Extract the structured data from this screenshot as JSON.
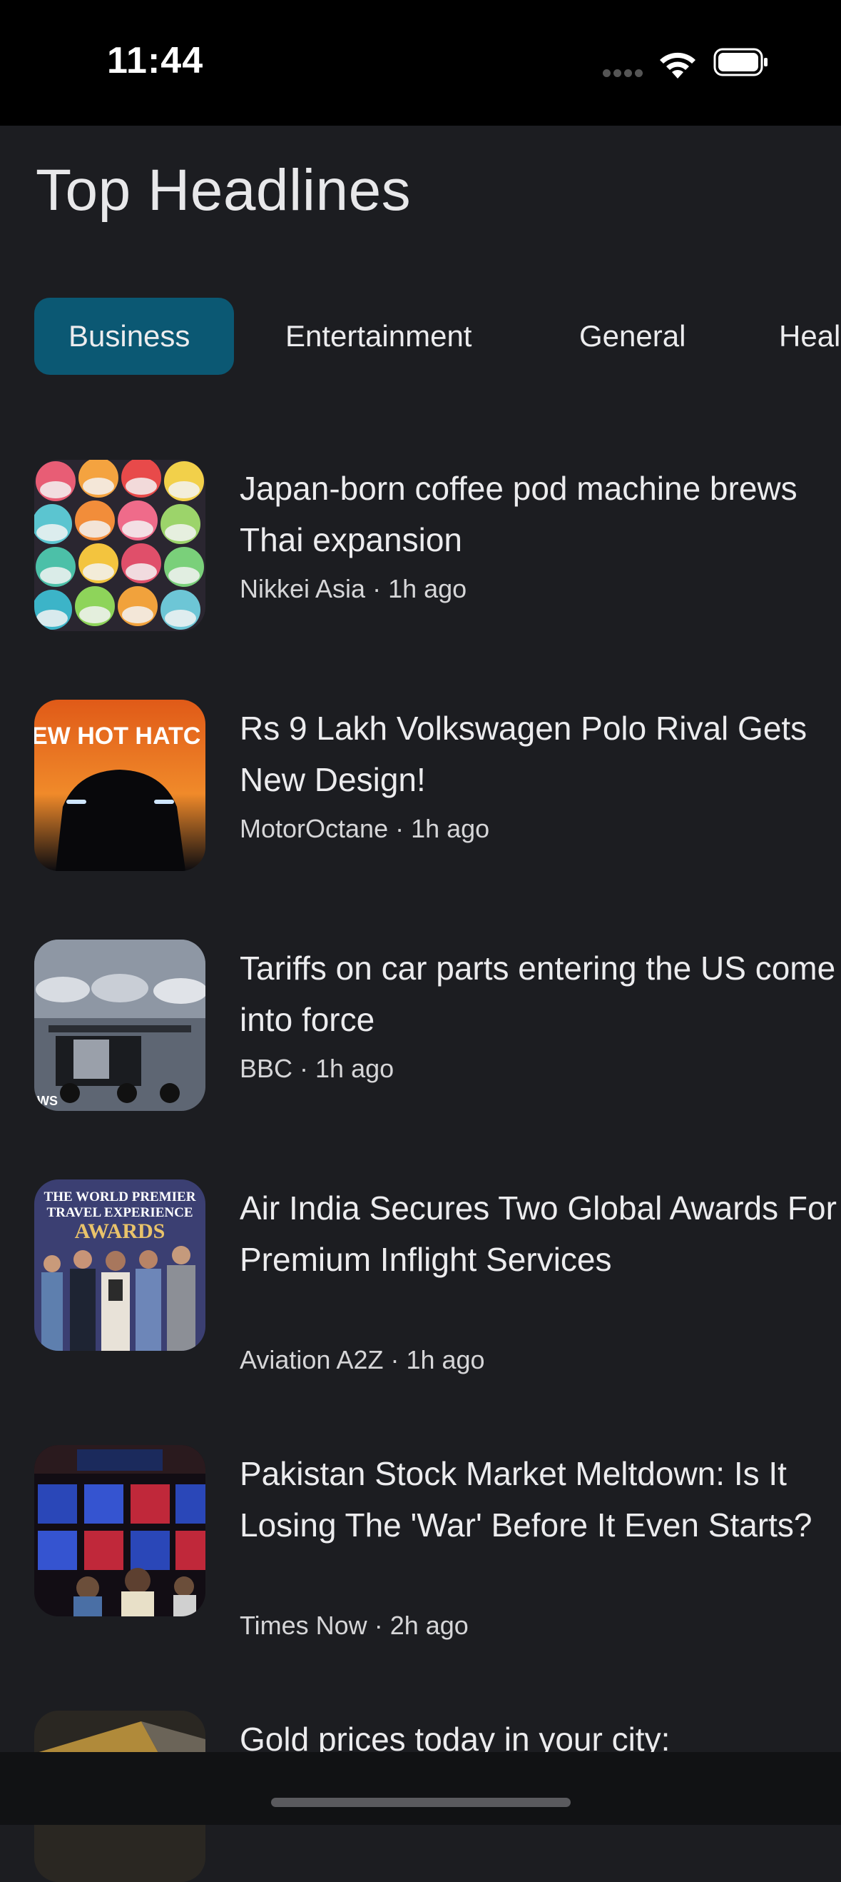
{
  "status": {
    "time": "11:44"
  },
  "page": {
    "title": "Top Headlines"
  },
  "tabs": [
    {
      "label": "Business"
    },
    {
      "label": "Entertainment"
    },
    {
      "label": "General"
    },
    {
      "label": "Heal"
    }
  ],
  "articles": [
    {
      "title": "Japan-born coffee pod machine brews Thai expansion",
      "source": "Nikkei Asia",
      "time": "1h ago"
    },
    {
      "title": "Rs 9 Lakh Volkswagen Polo Rival Gets New Design!",
      "source": "MotorOctane",
      "time": "1h ago",
      "thumb_text": "EW HOT HATC"
    },
    {
      "title": "Tariffs on car parts entering the US come into force",
      "source": "BBC",
      "time": "1h ago",
      "thumb_text": "WS"
    },
    {
      "title": "Air India Secures Two Global Awards For Premium Inflight Services",
      "source": "Aviation A2Z",
      "time": "1h ago",
      "thumb_text_1": "THE WORLD PREMIER",
      "thumb_text_2": "TRAVEL EXPERIENCE",
      "thumb_text_3": "AWARDS"
    },
    {
      "title": "Pakistan Stock Market Meltdown: Is It Losing The 'War' Before It Even Starts?",
      "source": "Times Now",
      "time": "2h ago"
    },
    {
      "title": "Gold prices today in your city:"
    }
  ],
  "colors": {
    "active_tab": "#0b5873",
    "background": "#1c1d21"
  }
}
